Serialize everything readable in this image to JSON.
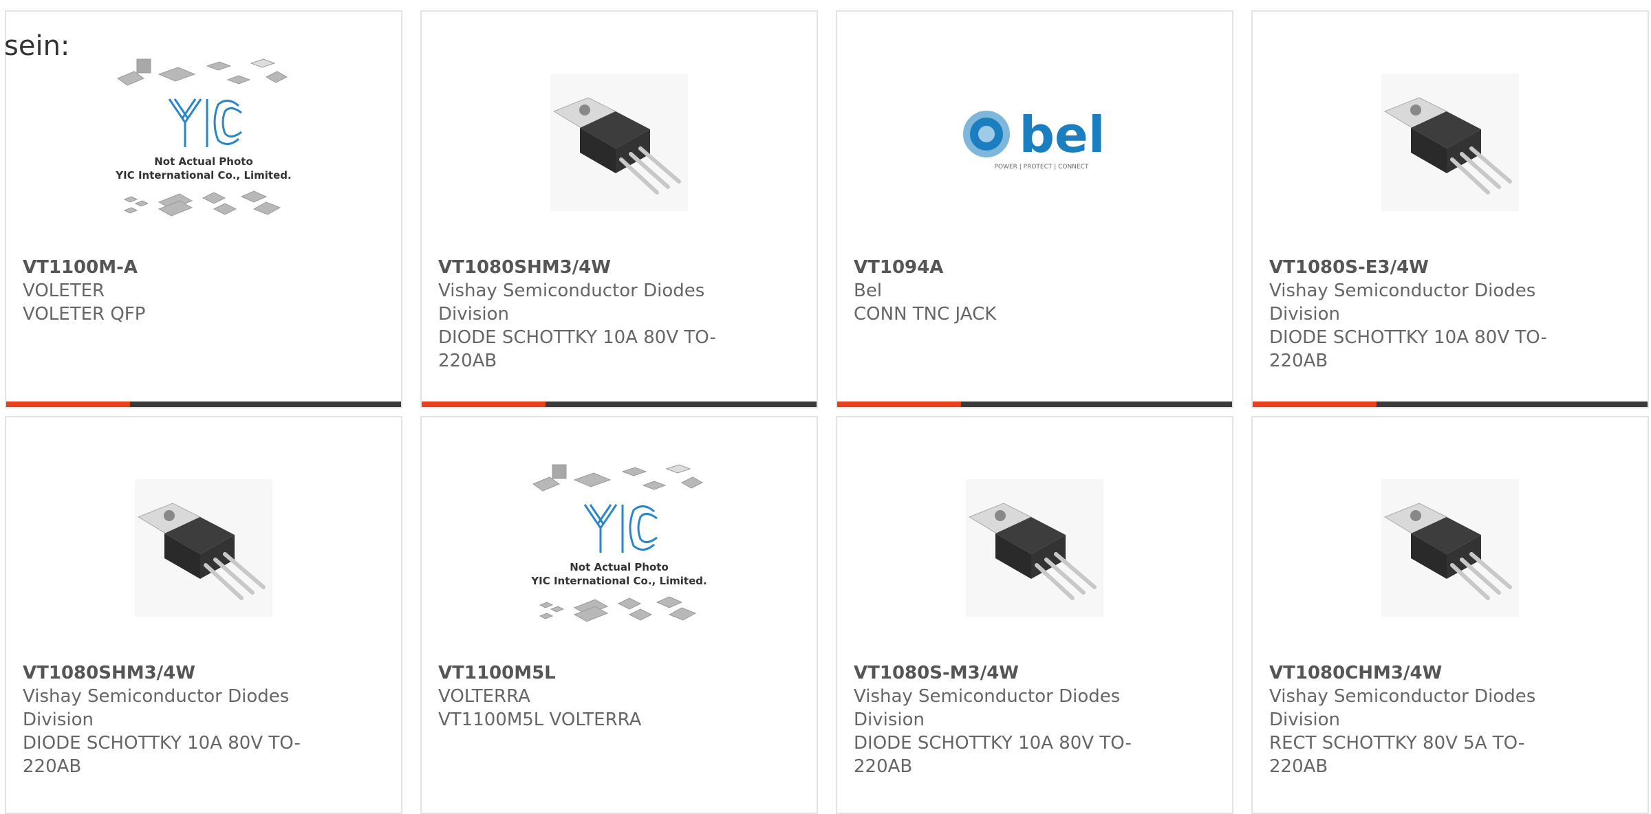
{
  "intro_text": "sein:",
  "placeholder": {
    "line1": "Not Actual Photo",
    "line2": "YIC International Co., Limited."
  },
  "bel_logo": {
    "text": "bel",
    "tagline": "POWER | PROTECT | CONNECT"
  },
  "colors": {
    "accent": "#e8401c",
    "bar": "#3a3a3a",
    "border": "#e3e3e3",
    "bel_blue": "#1b7fbf",
    "yic_blue": "#2a86c8"
  },
  "products": [
    {
      "part": "VT1100M-A",
      "manufacturer": "VOLETER",
      "description": "VOLETER QFP",
      "image": "yic-placeholder"
    },
    {
      "part": "VT1080SHM3/4W",
      "manufacturer": "Vishay Semiconductor Diodes Division",
      "description": "DIODE SCHOTTKY 10A 80V TO-220AB",
      "image": "to220-diode"
    },
    {
      "part": "VT1094A",
      "manufacturer": "Bel",
      "description": "CONN TNC JACK",
      "image": "bel-logo"
    },
    {
      "part": "VT1080S-E3/4W",
      "manufacturer": "Vishay Semiconductor Diodes Division",
      "description": "DIODE SCHOTTKY 10A 80V TO-220AB",
      "image": "to220-diode"
    },
    {
      "part": "VT1080SHM3/4W",
      "manufacturer": "Vishay Semiconductor Diodes Division",
      "description": "DIODE SCHOTTKY 10A 80V TO-220AB",
      "image": "to220-diode"
    },
    {
      "part": "VT1100M5L",
      "manufacturer": "VOLTERRA",
      "description": "VT1100M5L VOLTERRA",
      "image": "yic-placeholder"
    },
    {
      "part": "VT1080S-M3/4W",
      "manufacturer": "Vishay Semiconductor Diodes Division",
      "description": "DIODE SCHOTTKY 10A 80V TO-220AB",
      "image": "to220-diode"
    },
    {
      "part": "VT1080CHM3/4W",
      "manufacturer": "Vishay Semiconductor Diodes Division",
      "description": "RECT SCHOTTKY 80V 5A TO-220AB",
      "image": "to220-diode"
    }
  ]
}
